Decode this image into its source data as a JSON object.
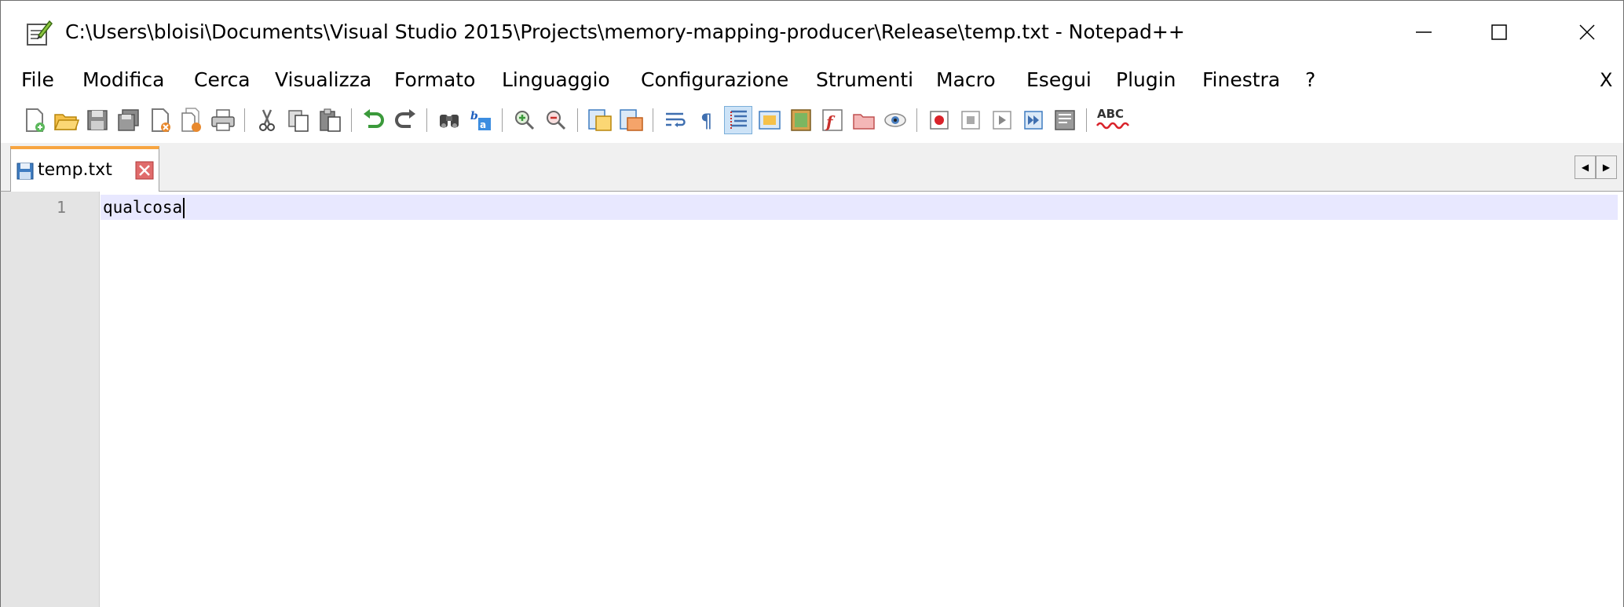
{
  "window": {
    "title": "C:\\Users\\bloisi\\Documents\\Visual Studio 2015\\Projects\\memory-mapping-producer\\Release\\temp.txt - Notepad++",
    "app_icon": "notepad-plus-plus-icon",
    "controls": [
      "minimize-icon",
      "maximize-icon",
      "close-icon"
    ]
  },
  "menu": {
    "items": [
      "File",
      "Modifica",
      "Cerca",
      "Visualizza",
      "Formato",
      "Linguaggio",
      "Configurazione",
      "Strumenti",
      "Macro",
      "Esegui",
      "Plugin",
      "Finestra",
      "?"
    ],
    "close_doc": "X"
  },
  "toolbar": {
    "spellcheck_label": "ABC",
    "icons": [
      "new-file",
      "open-file",
      "save",
      "save-all",
      "close",
      "close-all",
      "print",
      "cut",
      "copy",
      "paste",
      "undo",
      "redo",
      "find",
      "replace",
      "zoom-in",
      "zoom-out",
      "sync-vertical",
      "sync-horizontal",
      "word-wrap",
      "show-all-chars",
      "indent-guide",
      "user-defined-language",
      "document-map",
      "function-list",
      "folder-as-workspace",
      "monitoring",
      "record-macro",
      "stop-recording",
      "play-macro",
      "run-macro-multiple",
      "save-macro",
      "spell-check"
    ]
  },
  "tabs": [
    {
      "label": "temp.txt",
      "active": true
    }
  ],
  "editor": {
    "lines": [
      {
        "number": "1",
        "text": "qualcosa"
      }
    ]
  },
  "colors": {
    "tab_accent": "#f7a541",
    "gutter": "#e4e4e4",
    "current_line": "#e8e8ff",
    "active_tool": "#cde3f7"
  }
}
